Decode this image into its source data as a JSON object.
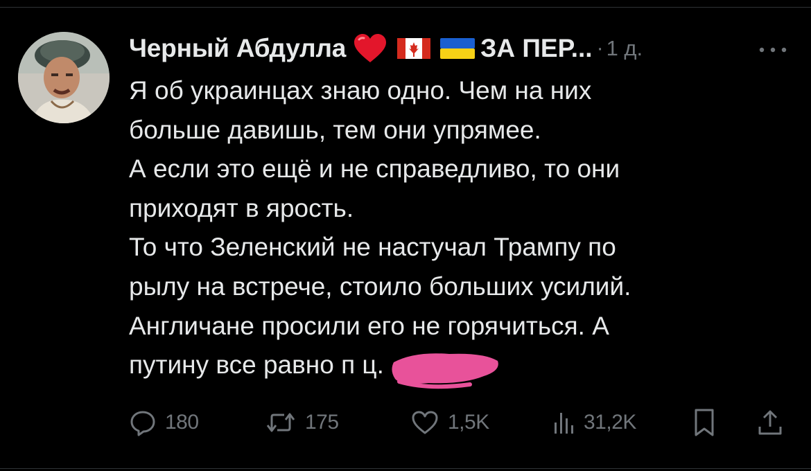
{
  "tweet": {
    "author_name": "Черный Абдулла",
    "name_suffix": "ЗА ПЕР...",
    "separator": "·",
    "time": "1 д.",
    "badges": [
      "heart-emoji",
      "canada-flag-emoji",
      "ukraine-flag-emoji"
    ],
    "text_lines": [
      "Я об украинцах знаю одно. Чем на них",
      "больше давишь, тем они упрямее.",
      "А если это ещё и не справедливо, то они",
      "приходят в ярость.",
      "То что Зеленский не настучал Трампу по",
      "рылу на встрече, стоило больших усилий.",
      "Англичане просили его не горячиться. А",
      "путину все равно п       ц."
    ]
  },
  "actions": {
    "replies": "180",
    "retweets": "175",
    "likes": "1,5K",
    "views": "31,2K"
  },
  "icons": {
    "more": "more-horizontal-icon",
    "reply": "reply-icon",
    "retweet": "retweet-icon",
    "like": "heart-icon",
    "views": "views-chart-icon",
    "bookmark": "bookmark-icon",
    "share": "share-icon"
  },
  "colors": {
    "background": "#000000",
    "text": "#e7e9ea",
    "secondary": "#71767b",
    "censor_mark": "#e8529a",
    "heart_emoji": "#e3162b"
  }
}
